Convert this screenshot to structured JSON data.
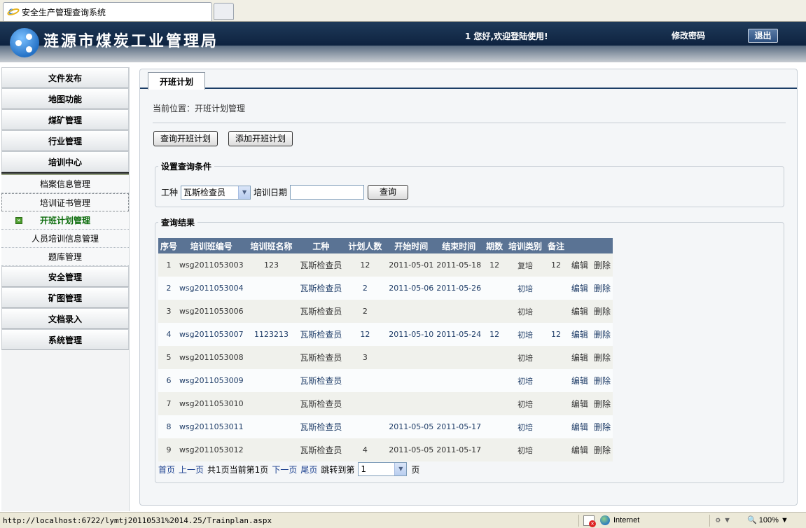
{
  "browser": {
    "tab_title": "安全生产管理查询系统",
    "status_url": "http://localhost:6722/lymtj20110531%2014.25/Trainplan.aspx",
    "zone": "Internet",
    "zoom": "100%",
    "zoom_arrow": "▼",
    "mode_arrow": "▼"
  },
  "header": {
    "org_title": "涟源市煤炭工业管理局",
    "greeting": "1 您好,欢迎登陆使用!",
    "change_password": "修改密码",
    "logout": "退出"
  },
  "sidebar": {
    "top_items": [
      "文件发布",
      "地图功能",
      "煤矿管理",
      "行业管理",
      "培训中心"
    ],
    "sub_items": [
      "档案信息管理",
      "培训证书管理",
      "开班计划管理",
      "人员培训信息管理",
      "题库管理"
    ],
    "active_sub": "开班计划管理",
    "bottom_items": [
      "安全管理",
      "矿图管理",
      "文档录入",
      "系统管理"
    ]
  },
  "main": {
    "tab_label": "开班计划",
    "breadcrumb": "当前位置：开班计划管理",
    "btn_query_plan": "查询开班计划",
    "btn_add_plan": "添加开班计划",
    "filter": {
      "legend": "设置查询条件",
      "job_label": "工种",
      "job_value": "瓦斯检查员",
      "date_label": "培训日期",
      "date_value": "",
      "query_button": "查询"
    },
    "results": {
      "legend": "查询结果",
      "columns": [
        "序号",
        "培训班编号",
        "培训班名称",
        "工种",
        "计划人数",
        "开始时间",
        "结束时间",
        "期数",
        "培训类别",
        "备注",
        "",
        ""
      ],
      "edit_label": "编辑",
      "delete_label": "删除",
      "rows": [
        [
          "1",
          "wsg2011053003",
          "123",
          "瓦斯检查员",
          "12",
          "2011-05-01",
          "2011-05-18",
          "12",
          "复培",
          "12"
        ],
        [
          "2",
          "wsg2011053004",
          "",
          "瓦斯检查员",
          "2",
          "2011-05-06",
          "2011-05-26",
          "",
          "初培",
          ""
        ],
        [
          "3",
          "wsg2011053006",
          "",
          "瓦斯检查员",
          "2",
          "",
          "",
          "",
          "初培",
          ""
        ],
        [
          "4",
          "wsg2011053007",
          "1123213",
          "瓦斯检查员",
          "12",
          "2011-05-10",
          "2011-05-24",
          "12",
          "初培",
          "12"
        ],
        [
          "5",
          "wsg2011053008",
          "",
          "瓦斯检查员",
          "3",
          "",
          "",
          "",
          "初培",
          ""
        ],
        [
          "6",
          "wsg2011053009",
          "",
          "瓦斯检查员",
          "",
          "",
          "",
          "",
          "初培",
          ""
        ],
        [
          "7",
          "wsg2011053010",
          "",
          "瓦斯检查员",
          "",
          "",
          "",
          "",
          "初培",
          ""
        ],
        [
          "8",
          "wsg2011053011",
          "",
          "瓦斯检查员",
          "",
          "2011-05-05",
          "2011-05-17",
          "",
          "初培",
          ""
        ],
        [
          "9",
          "wsg2011053012",
          "",
          "瓦斯检查员",
          "4",
          "2011-05-05",
          "2011-05-17",
          "",
          "初培",
          ""
        ]
      ]
    },
    "pager": {
      "first": "首页",
      "prev": "上一页",
      "info": "共1页当前第1页",
      "next": "下一页",
      "last": "尾页",
      "jump_label": "跳转到第",
      "page_value": "1",
      "page_suffix": "页"
    }
  },
  "colors": {
    "header_bg": "#0e2340",
    "table_header": "#5a7394",
    "link": "#1a3f8f",
    "active_menu": "#0a6b0a"
  }
}
